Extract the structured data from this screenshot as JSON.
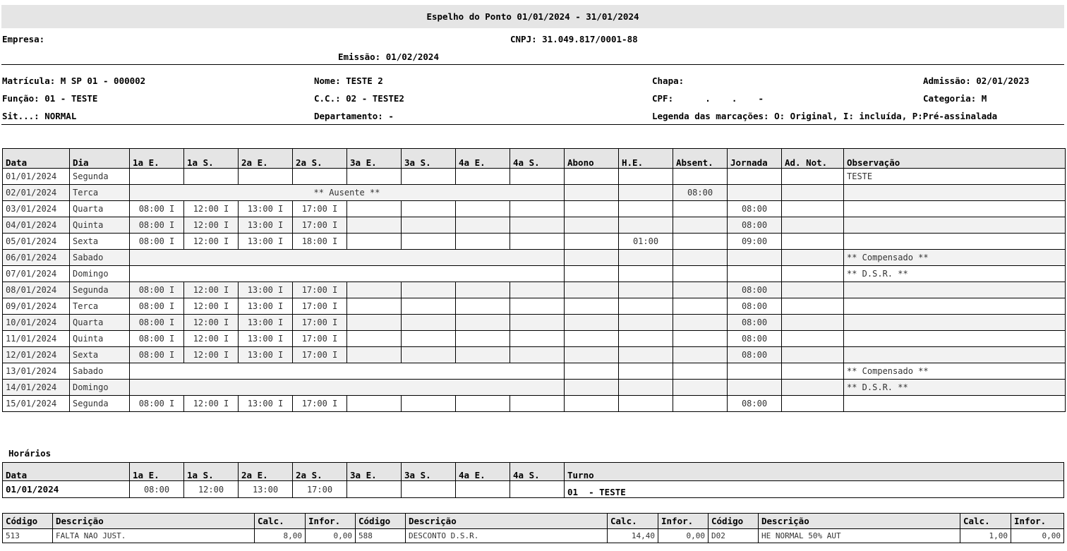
{
  "header": {
    "title": "Espelho do Ponto 01/01/2024 - 31/01/2024",
    "empresa_label": "Empresa:",
    "cnpj": "CNPJ: 31.049.817/0001-88",
    "emissao": "Emissão: 01/02/2024"
  },
  "employee": {
    "matricula": "Matrícula: M SP 01 - 000002",
    "nome": "Nome: TESTE 2",
    "chapa": "Chapa:",
    "admissao": "Admissão: 02/01/2023",
    "funcao": "Função: 01 - TESTE",
    "cc": "C.C.: 02 - TESTE2",
    "cpf": "CPF:      .    .    -",
    "categoria": "Categoria: M",
    "situacao": "Sit...: NORMAL",
    "departamento": "Departamento:  -",
    "legenda": "Legenda das marcações: O: Original, I: incluída, P:Pré-assinalada"
  },
  "main_table": {
    "headers": [
      "Data",
      "Dia",
      "1a E.",
      "1a S.",
      "2a E.",
      "2a S.",
      "3a E.",
      "3a S.",
      "4a E.",
      "4a S.",
      "Abono",
      "H.E.",
      "Absent.",
      "Jornada",
      "Ad. Not.",
      "Observação"
    ],
    "rows": [
      {
        "data": "01/01/2024",
        "dia": "Segunda",
        "span": "",
        "marks": [
          "",
          "",
          "",
          ""
        ],
        "abono": "",
        "he": "",
        "absent": "",
        "jornada": "",
        "adnot": "",
        "obs": "TESTE"
      },
      {
        "data": "02/01/2024",
        "dia": "Terca",
        "span": "** Ausente **",
        "marks": [],
        "abono": "",
        "he": "",
        "absent": "08:00",
        "jornada": "",
        "adnot": "",
        "obs": ""
      },
      {
        "data": "03/01/2024",
        "dia": "Quarta",
        "span": "",
        "marks": [
          "08:00 I",
          "12:00 I",
          "13:00 I",
          "17:00 I"
        ],
        "abono": "",
        "he": "",
        "absent": "",
        "jornada": "08:00",
        "adnot": "",
        "obs": ""
      },
      {
        "data": "04/01/2024",
        "dia": "Quinta",
        "span": "",
        "marks": [
          "08:00 I",
          "12:00 I",
          "13:00 I",
          "17:00 I"
        ],
        "abono": "",
        "he": "",
        "absent": "",
        "jornada": "08:00",
        "adnot": "",
        "obs": ""
      },
      {
        "data": "05/01/2024",
        "dia": "Sexta",
        "span": "",
        "marks": [
          "08:00 I",
          "12:00 I",
          "13:00 I",
          "18:00 I"
        ],
        "abono": "",
        "he": "01:00",
        "absent": "",
        "jornada": "09:00",
        "adnot": "",
        "obs": ""
      },
      {
        "data": "06/01/2024",
        "dia": "Sabado",
        "span": "",
        "marks": [],
        "abono": "",
        "he": "",
        "absent": "",
        "jornada": "",
        "adnot": "",
        "obs": "** Compensado **"
      },
      {
        "data": "07/01/2024",
        "dia": "Domingo",
        "span": "",
        "marks": [],
        "abono": "",
        "he": "",
        "absent": "",
        "jornada": "",
        "adnot": "",
        "obs": "** D.S.R. **"
      },
      {
        "data": "08/01/2024",
        "dia": "Segunda",
        "span": "",
        "marks": [
          "08:00 I",
          "12:00 I",
          "13:00 I",
          "17:00 I"
        ],
        "abono": "",
        "he": "",
        "absent": "",
        "jornada": "08:00",
        "adnot": "",
        "obs": ""
      },
      {
        "data": "09/01/2024",
        "dia": "Terca",
        "span": "",
        "marks": [
          "08:00 I",
          "12:00 I",
          "13:00 I",
          "17:00 I"
        ],
        "abono": "",
        "he": "",
        "absent": "",
        "jornada": "08:00",
        "adnot": "",
        "obs": ""
      },
      {
        "data": "10/01/2024",
        "dia": "Quarta",
        "span": "",
        "marks": [
          "08:00 I",
          "12:00 I",
          "13:00 I",
          "17:00 I"
        ],
        "abono": "",
        "he": "",
        "absent": "",
        "jornada": "08:00",
        "adnot": "",
        "obs": ""
      },
      {
        "data": "11/01/2024",
        "dia": "Quinta",
        "span": "",
        "marks": [
          "08:00 I",
          "12:00 I",
          "13:00 I",
          "17:00 I"
        ],
        "abono": "",
        "he": "",
        "absent": "",
        "jornada": "08:00",
        "adnot": "",
        "obs": ""
      },
      {
        "data": "12/01/2024",
        "dia": "Sexta",
        "span": "",
        "marks": [
          "08:00 I",
          "12:00 I",
          "13:00 I",
          "17:00 I"
        ],
        "abono": "",
        "he": "",
        "absent": "",
        "jornada": "08:00",
        "adnot": "",
        "obs": ""
      },
      {
        "data": "13/01/2024",
        "dia": "Sabado",
        "span": "",
        "marks": [],
        "abono": "",
        "he": "",
        "absent": "",
        "jornada": "",
        "adnot": "",
        "obs": "** Compensado **"
      },
      {
        "data": "14/01/2024",
        "dia": "Domingo",
        "span": "",
        "marks": [],
        "abono": "",
        "he": "",
        "absent": "",
        "jornada": "",
        "adnot": "",
        "obs": "** D.S.R. **"
      },
      {
        "data": "15/01/2024",
        "dia": "Segunda",
        "span": "",
        "marks": [
          "08:00 I",
          "12:00 I",
          "13:00 I",
          "17:00 I"
        ],
        "abono": "",
        "he": "",
        "absent": "",
        "jornada": "08:00",
        "adnot": "",
        "obs": ""
      }
    ]
  },
  "horarios": {
    "label": "Horários",
    "headers": [
      "Data",
      "1a E.",
      "1a S.",
      "2a E.",
      "2a S.",
      "3a E.",
      "3a S.",
      "4a E.",
      "4a S.",
      "Turno"
    ],
    "row": {
      "data": "01/01/2024",
      "times": [
        "08:00",
        "12:00",
        "13:00",
        "17:00",
        "",
        "",
        "",
        ""
      ],
      "turno": "01  - TESTE"
    }
  },
  "events": {
    "headers": [
      "Código",
      "Descrição",
      "Calc.",
      "Infor.",
      "Código",
      "Descrição",
      "Calc.",
      "Infor.",
      "Código",
      "Descrição",
      "Calc.",
      "Infor."
    ],
    "row": [
      "513",
      "FALTA NAO JUST.",
      "8,00",
      "0,00",
      "588",
      "DESCONTO D.S.R.",
      "14,40",
      "0,00",
      "D02",
      "HE NORMAL 50% AUT",
      "1,00",
      "0,00"
    ]
  }
}
